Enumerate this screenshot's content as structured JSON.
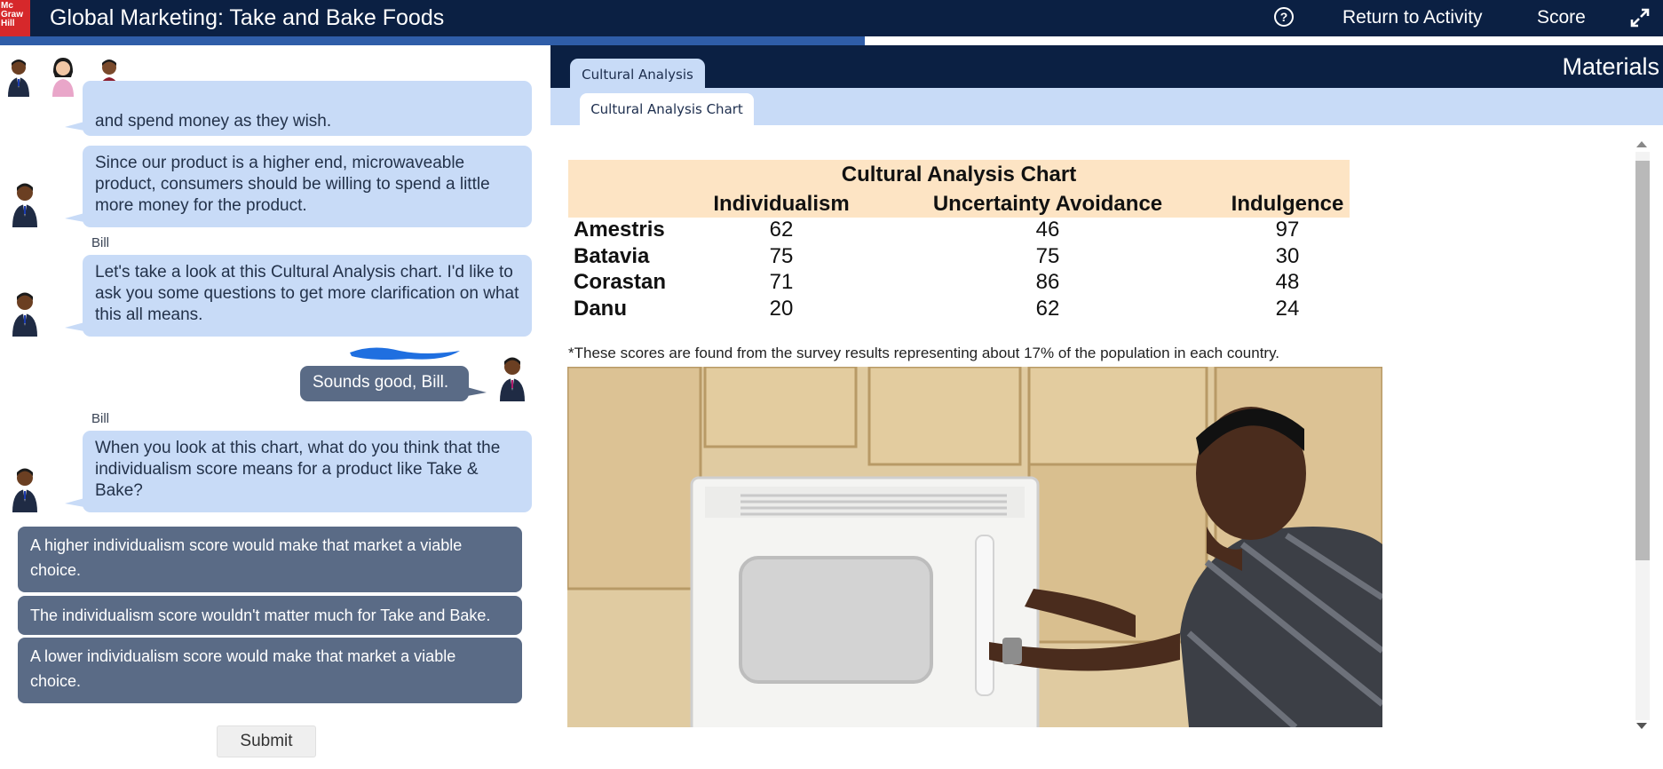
{
  "header": {
    "logo_lines": [
      "Mc",
      "Graw",
      "Hill"
    ],
    "title": "Global Marketing: Take and Bake Foods",
    "help_symbol": "?",
    "return_label": "Return to Activity",
    "score_label": "Score",
    "progress_fraction": 0.52
  },
  "chat": {
    "messages": [
      {
        "speaker": "",
        "role": "npc",
        "text": "and spend money as they wish."
      },
      {
        "speaker": "",
        "role": "npc",
        "text": "Since our product is a higher end, microwaveable product, consumers should be willing to spend a little more money for the product."
      },
      {
        "speaker": "Bill",
        "role": "npc",
        "text": "Let's take a look at this Cultural Analysis chart. I'd like to ask you some questions to get more clarification on what this all means."
      },
      {
        "speaker": "",
        "role": "user",
        "text": "Sounds good, Bill."
      },
      {
        "speaker": "Bill",
        "role": "npc",
        "text": "When you look at this chart, what do you think that the individualism score means for a product like Take & Bake?"
      }
    ],
    "options": [
      "A higher individualism score would make that market a viable choice.",
      "The individualism score wouldn't matter much for Take and Bake.",
      "A lower individualism score would make that market a viable choice."
    ],
    "submit_label": "Submit"
  },
  "materials": {
    "panel_title": "Materials",
    "tab_label": "Cultural Analysis",
    "subtab_label": "Cultural Analysis Chart",
    "footnote": "*These scores are found from the survey results representing about 17% of the population in each country."
  },
  "chart_data": {
    "type": "table",
    "title": "Cultural Analysis Chart",
    "columns": [
      "Individualism",
      "Uncertainty Avoidance",
      "Indulgence"
    ],
    "rows": [
      {
        "country": "Amestris",
        "values": [
          62,
          46,
          97
        ]
      },
      {
        "country": "Batavia",
        "values": [
          75,
          75,
          30
        ]
      },
      {
        "country": "Corastan",
        "values": [
          71,
          86,
          48
        ]
      },
      {
        "country": "Danu",
        "values": [
          20,
          62,
          24
        ]
      }
    ]
  },
  "colors": {
    "navy": "#0b2043",
    "bubble": "#c8dbf7",
    "option": "#5a6b86",
    "chart_header": "#fde4c4",
    "logo_red": "#d6282b",
    "progress": "#2f5da8"
  }
}
